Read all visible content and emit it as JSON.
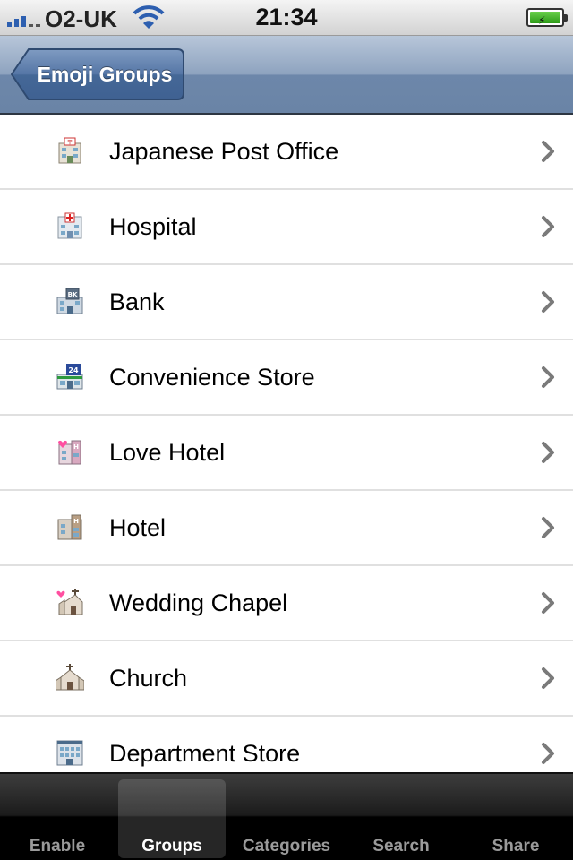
{
  "status_bar": {
    "carrier": "O2-UK",
    "time": "21:34"
  },
  "nav": {
    "back_label": "Emoji Groups"
  },
  "list": {
    "items": [
      {
        "label": "Japanese Post Office",
        "icon": "japanese-post-office-icon"
      },
      {
        "label": "Hospital",
        "icon": "hospital-icon"
      },
      {
        "label": "Bank",
        "icon": "bank-icon"
      },
      {
        "label": "Convenience Store",
        "icon": "convenience-store-icon"
      },
      {
        "label": "Love Hotel",
        "icon": "love-hotel-icon"
      },
      {
        "label": "Hotel",
        "icon": "hotel-icon"
      },
      {
        "label": "Wedding Chapel",
        "icon": "wedding-chapel-icon"
      },
      {
        "label": "Church",
        "icon": "church-icon"
      },
      {
        "label": "Department Store",
        "icon": "department-store-icon"
      }
    ]
  },
  "tab_bar": {
    "selected": "Groups",
    "tabs": [
      {
        "label": "Enable"
      },
      {
        "label": "Groups"
      },
      {
        "label": "Categories"
      },
      {
        "label": "Search"
      },
      {
        "label": "Share"
      }
    ]
  },
  "colors": {
    "nav_blue": "#6d87aa",
    "tab_bar_black": "#000000",
    "battery_green": "#2c9a17"
  }
}
